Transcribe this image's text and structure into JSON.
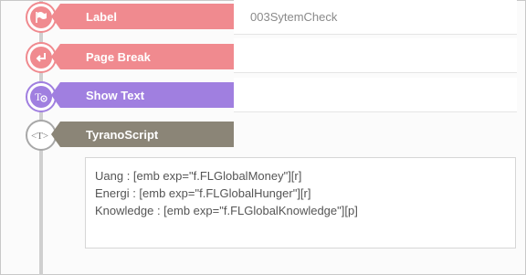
{
  "rows": [
    {
      "label": "Label",
      "value": "003SytemCheck",
      "color": "#f08a8f",
      "icon": "flag-icon"
    },
    {
      "label": "Page Break",
      "value": "",
      "color": "#f08a8f",
      "icon": "return-arrow-icon"
    },
    {
      "label": "Show Text",
      "value": "",
      "color": "#a07fe0",
      "icon": "text-eye-icon"
    },
    {
      "label": "TyranoScript",
      "value": "",
      "color": "#8b8577",
      "icon": "tag-t-icon"
    }
  ],
  "script_lines": [
    "Uang : [emb exp=\"f.FLGlobalMoney\"][r]",
    "Energi : [emb exp=\"f.FLGlobalHunger\"][r]",
    "Knowledge : [emb exp=\"f.FLGlobalKnowledge\"][p]"
  ]
}
